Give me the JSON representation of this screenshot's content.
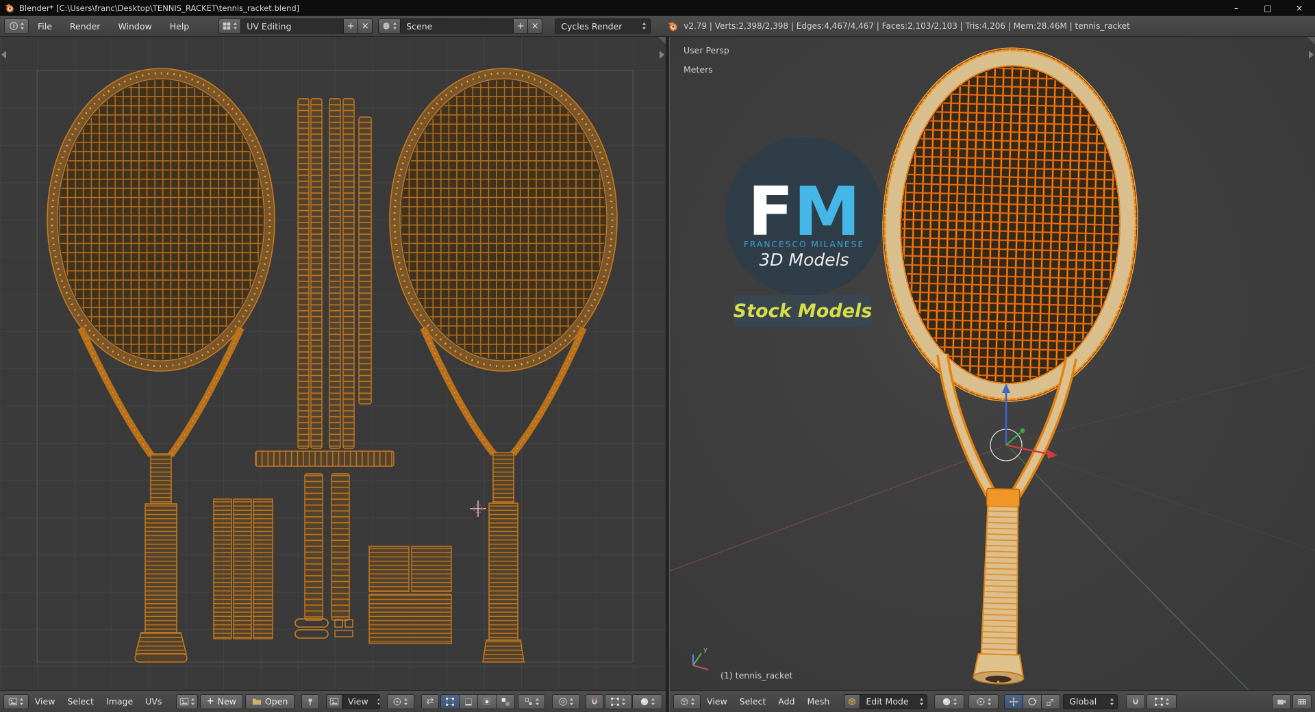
{
  "window": {
    "title": "Blender* [C:\\Users\\franc\\Desktop\\TENNIS_RACKET\\tennis_racket.blend]"
  },
  "icons": {
    "plus": "+",
    "close": "×",
    "minimize": "–",
    "maximize": "□",
    "sync": "⇄"
  },
  "info_header": {
    "menus": [
      "File",
      "Render",
      "Window",
      "Help"
    ],
    "layout": {
      "value": "UV Editing"
    },
    "scene": {
      "value": "Scene"
    },
    "engine": {
      "value": "Cycles Render"
    },
    "stats": "v2.79 | Verts:2,398/2,398 | Edges:4,467/4,467 | Faces:2,103/2,103 | Tris:4,206 | Mem:28.46M | tennis_racket"
  },
  "uv_editor": {
    "header": {
      "menus": [
        "View",
        "Select",
        "Image",
        "UVs"
      ],
      "new_button": "New",
      "open_button": "Open",
      "mode_dropdown": "View"
    }
  },
  "viewport_3d": {
    "overlay": {
      "view_name": "User Persp",
      "unit": "Meters",
      "object_info": "(1) tennis_racket",
      "axis_y": "y"
    },
    "logo": {
      "initial_f": "F",
      "initial_m": "M",
      "name": "FRANCESCO MILANESE",
      "tagline": "3D Models",
      "badge": "Stock Models"
    },
    "header": {
      "menus": [
        "View",
        "Select",
        "Add",
        "Mesh"
      ],
      "mode": "Edit Mode",
      "orientation": "Global"
    }
  },
  "colors": {
    "accent_orange": "#ff9a2b",
    "wire_orange": "#c9791c",
    "frame_tan": "#d9bf8e",
    "logo_blue": "#45b6e8",
    "badge_yellow": "#d6de4a",
    "header_bg": "#454545",
    "viewport_bg": "#3e3e3e",
    "uv_bg": "#3a3a3a"
  }
}
